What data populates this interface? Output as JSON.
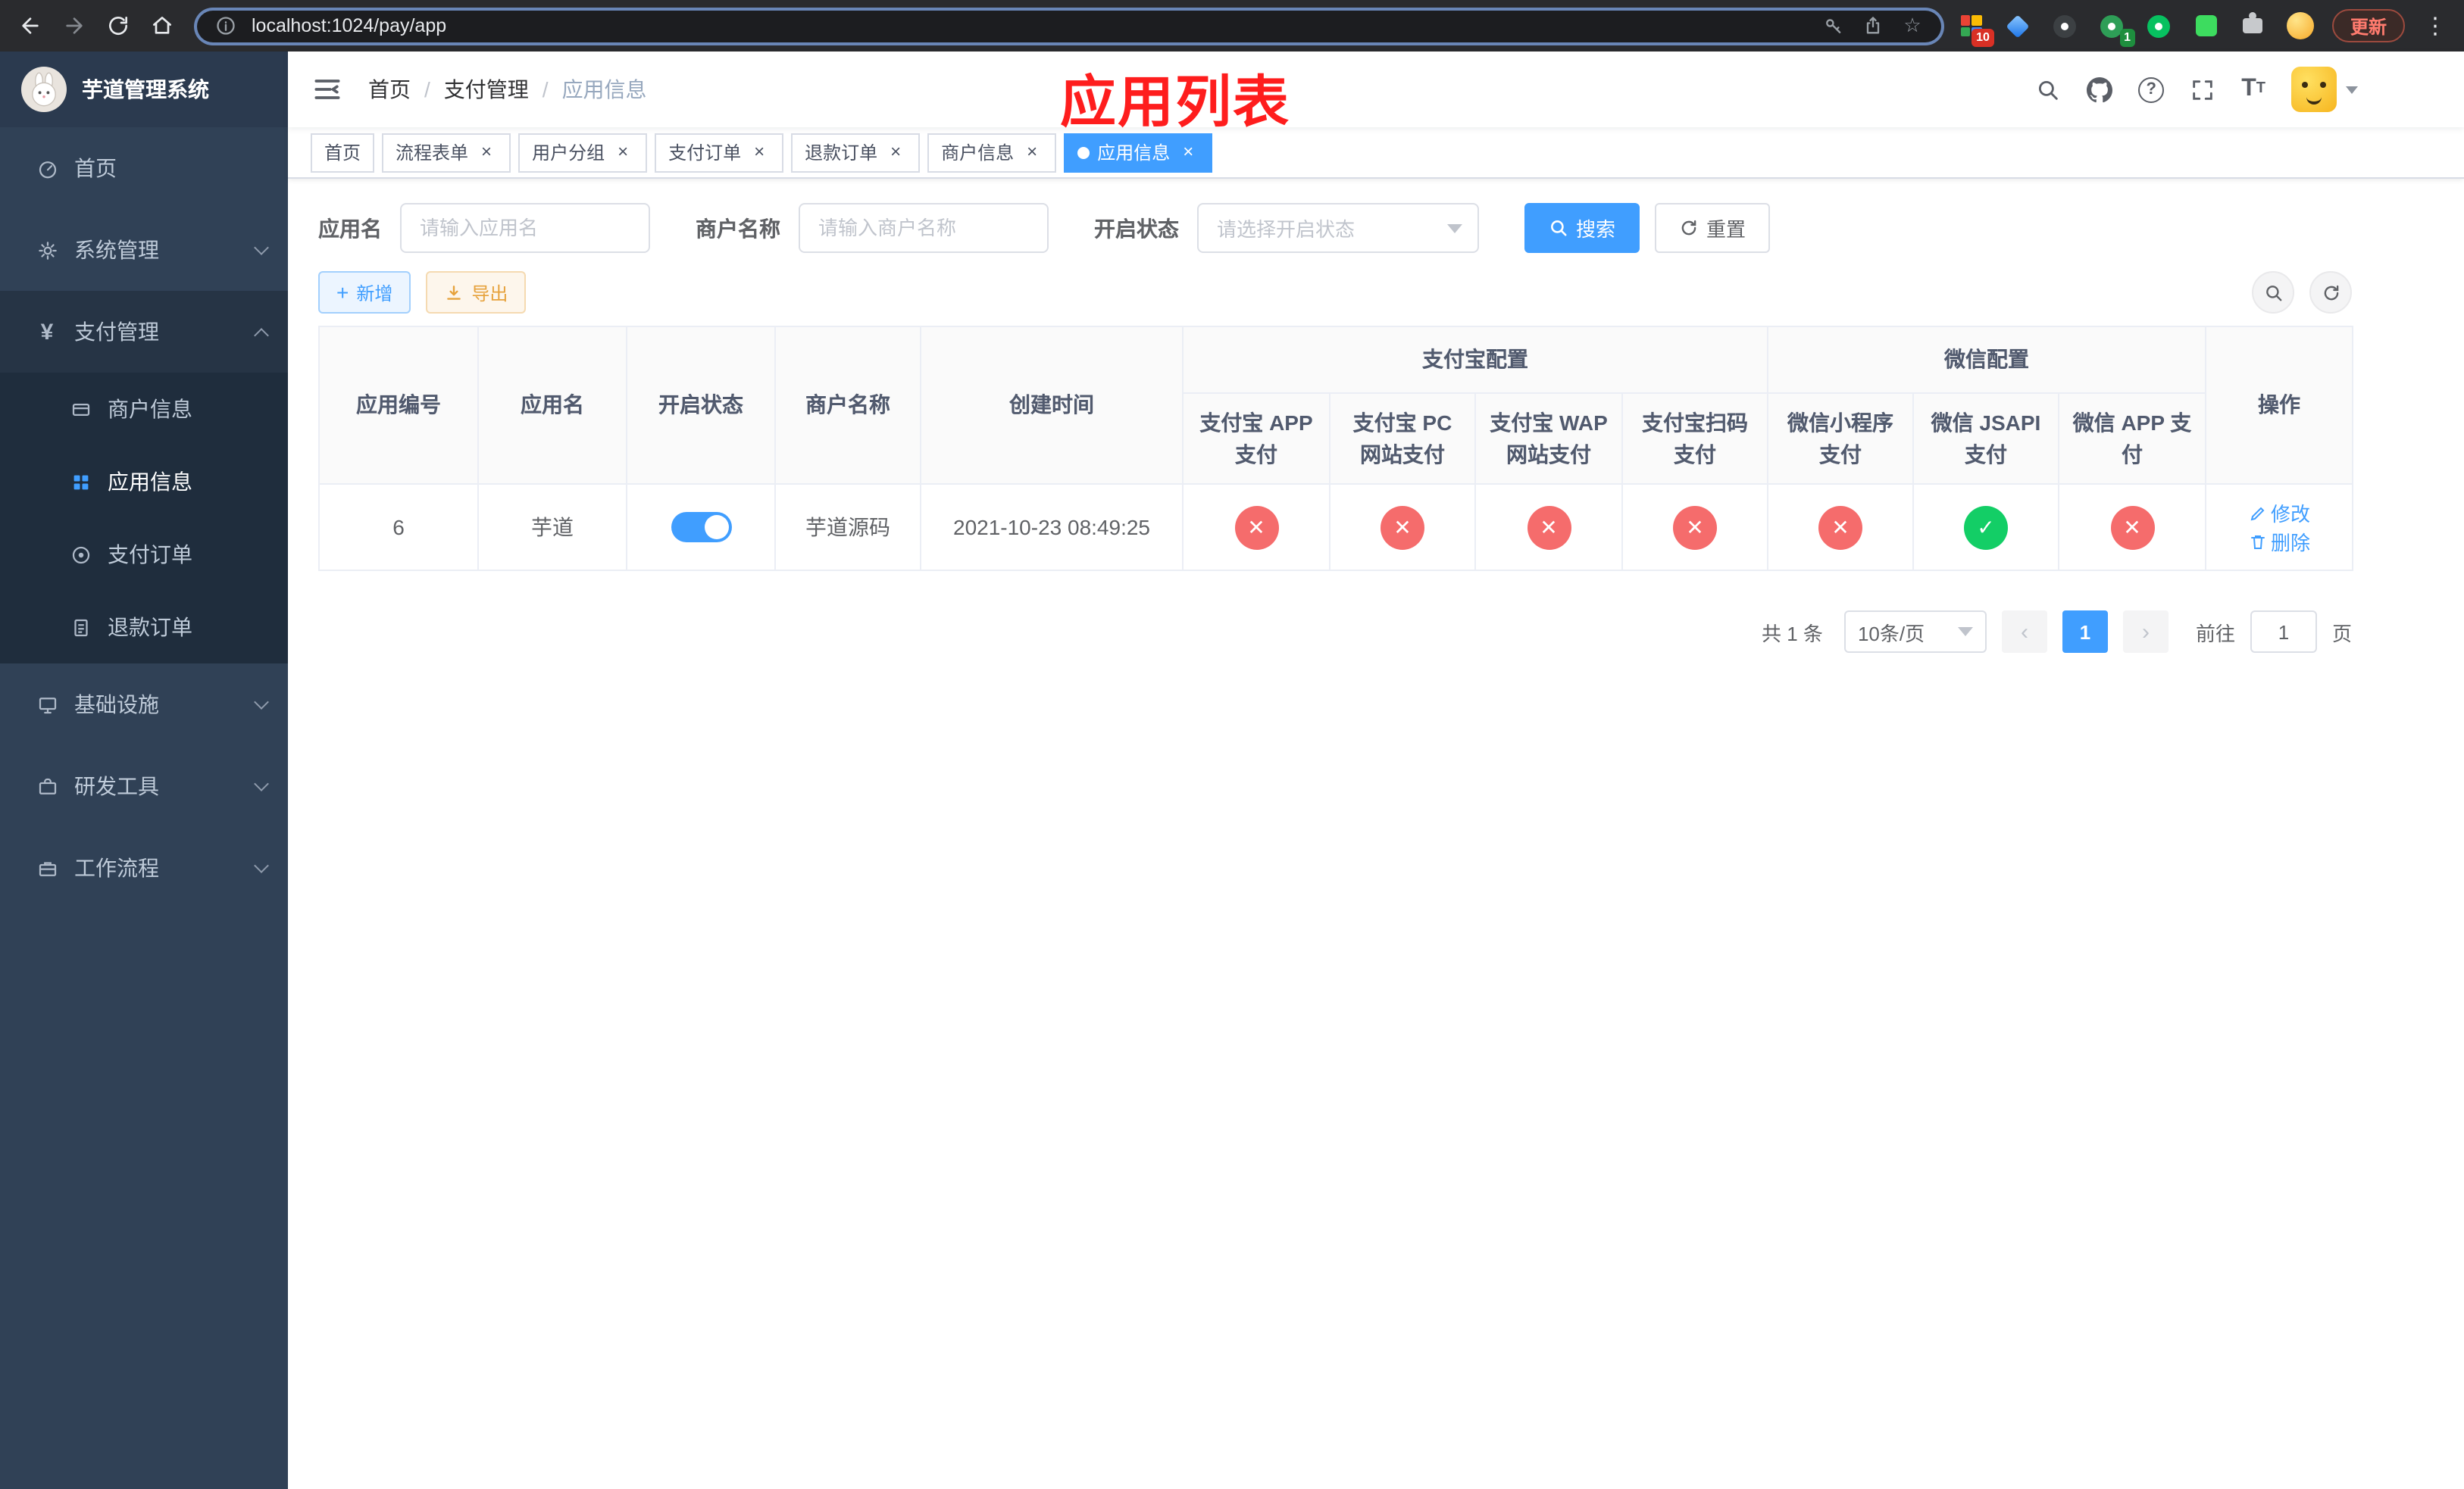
{
  "browser": {
    "url": "localhost:1024/pay/app",
    "update_label": "更新",
    "ext_badge_a": "10",
    "ext_badge_b": "1"
  },
  "glyphs": {
    "plus": "+",
    "close": "×",
    "star": "☆",
    "kebab": "⋮",
    "question": "?",
    "yen": "¥",
    "prev": "‹",
    "next": "›",
    "font_large": "T",
    "font_small": "T",
    "check": "✓",
    "cross": "✕"
  },
  "sidebar": {
    "title": "芋道管理系统",
    "menu": [
      {
        "label": "首页"
      },
      {
        "label": "系统管理"
      },
      {
        "label": "支付管理"
      },
      {
        "label": "基础设施"
      },
      {
        "label": "研发工具"
      },
      {
        "label": "工作流程"
      }
    ],
    "submenu": [
      {
        "label": "商户信息"
      },
      {
        "label": "应用信息"
      },
      {
        "label": "支付订单"
      },
      {
        "label": "退款订单"
      }
    ]
  },
  "header": {
    "breadcrumb": {
      "home": "首页",
      "section": "支付管理",
      "current": "应用信息"
    },
    "overlay_title": "应用列表"
  },
  "tabs": [
    {
      "label": "首页"
    },
    {
      "label": "流程表单"
    },
    {
      "label": "用户分组"
    },
    {
      "label": "支付订单"
    },
    {
      "label": "退款订单"
    },
    {
      "label": "商户信息"
    },
    {
      "label": "应用信息"
    }
  ],
  "filters": {
    "app_name_label": "应用名",
    "app_name_placeholder": "请输入应用名",
    "merchant_label": "商户名称",
    "merchant_placeholder": "请输入商户名称",
    "status_label": "开启状态",
    "status_placeholder": "请选择开启状态",
    "search_label": "搜索",
    "reset_label": "重置"
  },
  "toolbar_actions": {
    "add_label": "新增",
    "export_label": "导出"
  },
  "table": {
    "columns": {
      "app_id": "应用编号",
      "app_name": "应用名",
      "status": "开启状态",
      "merchant": "商户名称",
      "create_time": "创建时间",
      "alipay_group": "支付宝配置",
      "alipay_app": "支付宝 APP 支付",
      "alipay_pc": "支付宝 PC 网站支付",
      "alipay_wap": "支付宝 WAP 网站支付",
      "alipay_qr": "支付宝扫码支付",
      "wechat_group": "微信配置",
      "wechat_mini": "微信小程序支付",
      "wechat_jsapi": "微信 JSAPI 支付",
      "wechat_app": "微信 APP 支付",
      "actions": "操作"
    },
    "rows": [
      {
        "app_id": "6",
        "app_name": "芋道",
        "status_on": true,
        "merchant": "芋道源码",
        "create_time": "2021-10-23 08:49:25",
        "channels": {
          "alipay_app": false,
          "alipay_pc": false,
          "alipay_wap": false,
          "alipay_qr": false,
          "wechat_mini": false,
          "wechat_jsapi": true,
          "wechat_app": false
        },
        "edit_label": "修改",
        "delete_label": "删除"
      }
    ]
  },
  "pagination": {
    "total_text": "共 1 条",
    "page_size": "10条/页",
    "current_page": "1",
    "goto_label": "前往",
    "goto_value": "1",
    "page_unit": "页"
  }
}
